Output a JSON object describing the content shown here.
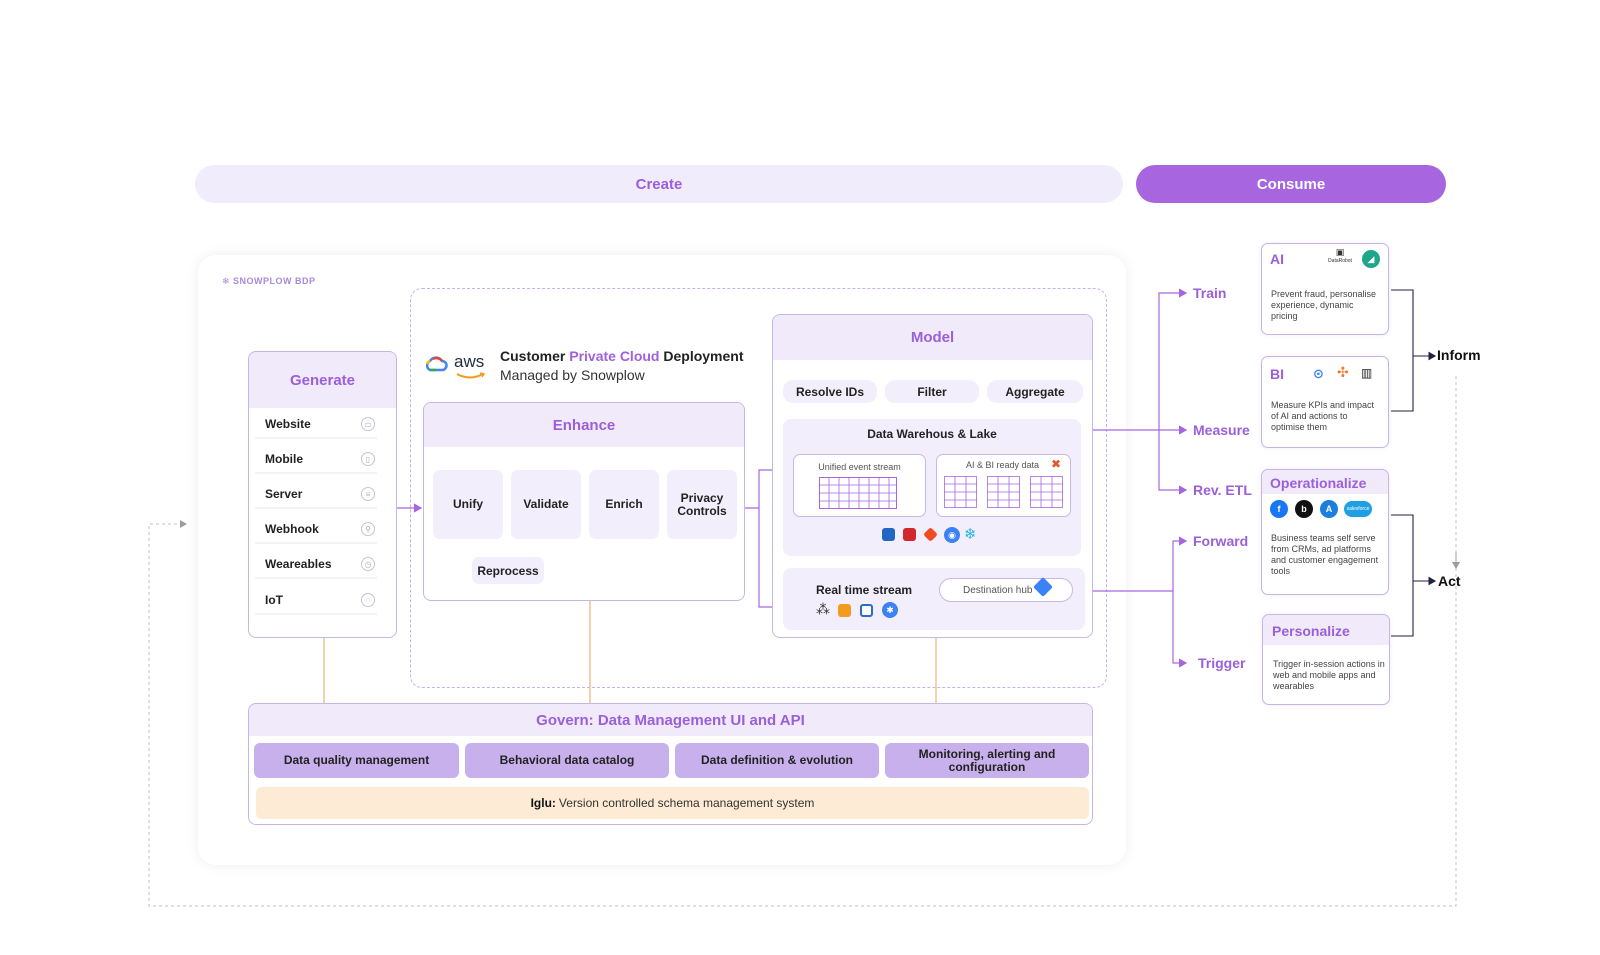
{
  "phases": {
    "create": "Create",
    "consume": "Consume"
  },
  "brand": {
    "name": "SNOWPLOW BDP"
  },
  "deployment": {
    "aws": "aws",
    "title_prefix": "Customer ",
    "title_highlight": "Private Cloud",
    "title_suffix": " Deployment",
    "subtitle": "Managed by Snowplow"
  },
  "generate": {
    "title": "Generate",
    "items": [
      {
        "label": "Website",
        "icon": "browser-icon"
      },
      {
        "label": "Mobile",
        "icon": "mobile-icon"
      },
      {
        "label": "Server",
        "icon": "server-icon"
      },
      {
        "label": "Webhook",
        "icon": "webhook-icon"
      },
      {
        "label": "Weareables",
        "icon": "watch-icon"
      },
      {
        "label": "IoT",
        "icon": "iot-icon"
      }
    ]
  },
  "enhance": {
    "title": "Enhance",
    "steps": [
      "Unify",
      "Validate",
      "Enrich",
      "Privacy Controls"
    ],
    "reprocess": "Reprocess"
  },
  "model": {
    "title": "Model",
    "ops": [
      "Resolve IDs",
      "Filter",
      "Aggregate"
    ],
    "warehouse_title": "Data Warehous & Lake",
    "unified_label": "Unified event stream",
    "ready_label": "AI & BI ready data",
    "realtime_title": "Real time stream",
    "destination_hub": "Destination hub"
  },
  "govern": {
    "title": "Govern: Data Management UI and API",
    "items": [
      "Data quality management",
      "Behavioral data catalog",
      "Data definition & evolution",
      "Monitoring, alerting and configuration"
    ],
    "iglu_bold": "Iglu:",
    "iglu_text": "Version controlled schema management system"
  },
  "destinations": {
    "train": "Train",
    "measure": "Measure",
    "rev_etl": "Rev. ETL",
    "forward": "Forward",
    "trigger": "Trigger"
  },
  "cards": {
    "ai": {
      "title": "AI",
      "desc": "Prevent fraud, personalise experience, dynamic pricing",
      "logo_text": "DataRobot"
    },
    "bi": {
      "title": "BI",
      "desc": "Measure KPIs and impact of AI and actions to optimise them"
    },
    "operationalize": {
      "title": "Operationalize",
      "desc": "Business teams self serve from CRMs, ad platforms and customer engagement tools",
      "salesforce": "salesforce"
    },
    "personalize": {
      "title": "Personalize",
      "desc": "Trigger in-session actions in web and mobile apps and wearables"
    }
  },
  "outcomes": {
    "inform": "Inform",
    "act": "Act"
  },
  "colors": {
    "purple": "#a766e0",
    "purple_text": "#9b5fd9",
    "lavender": "#f1ecfb",
    "orange_line": "#f0c089",
    "iglu_bg": "#fdebd5"
  }
}
